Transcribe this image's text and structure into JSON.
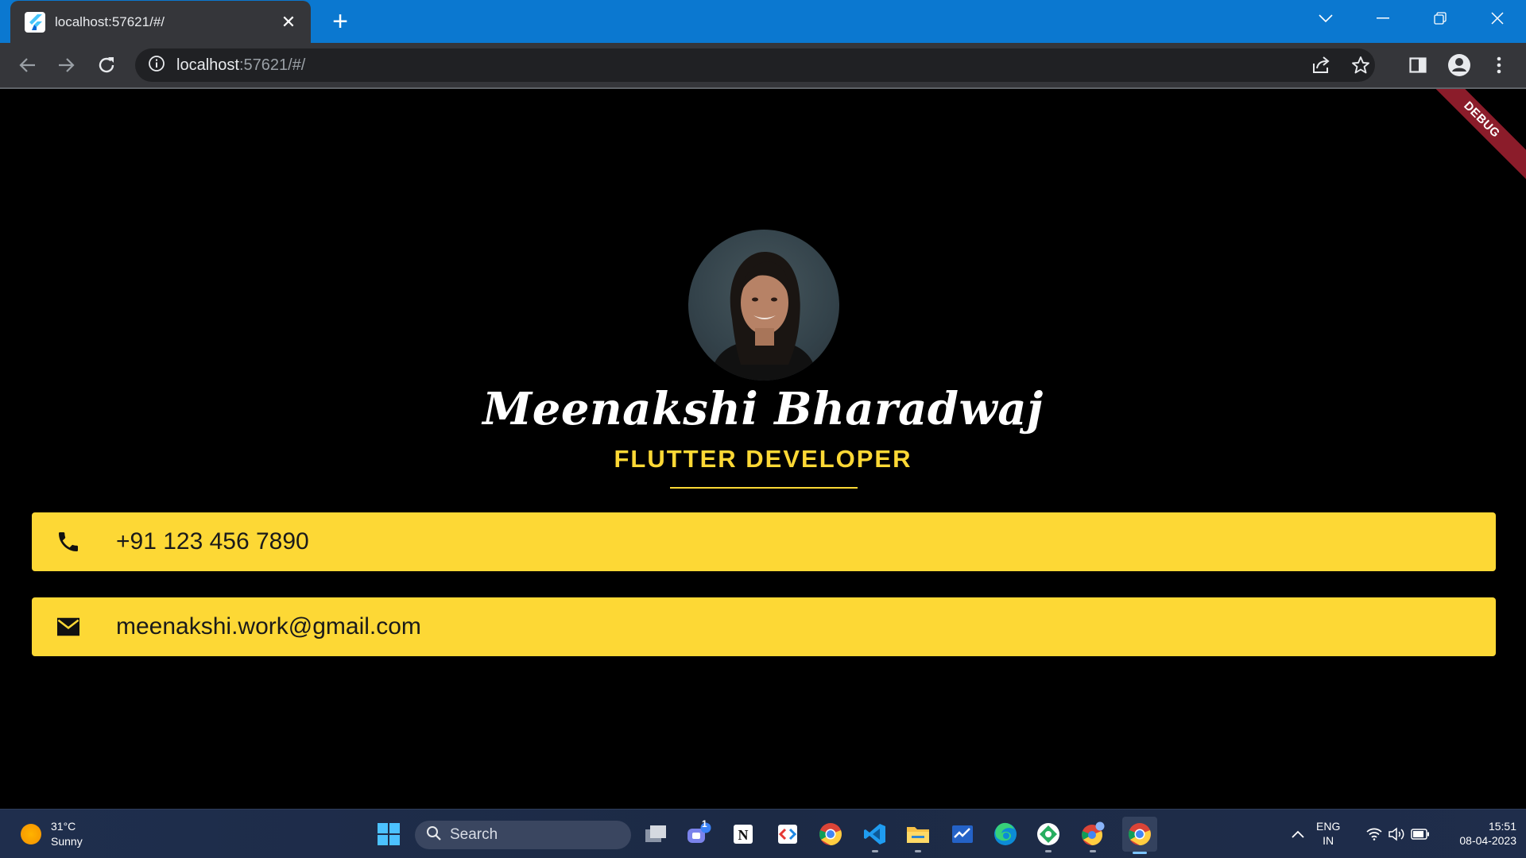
{
  "browser": {
    "tab_title": "localhost:57621/#/",
    "url_host": "localhost",
    "url_rest": ":57621/#/"
  },
  "page": {
    "debug_label": "DEBUG",
    "name": "Meenakshi Bharadwaj",
    "role": "FLUTTER DEVELOPER",
    "phone": "+91 123 456 7890",
    "email": "meenakshi.work@gmail.com",
    "colors": {
      "accent": "#fdd835",
      "background": "#000000",
      "card_text": "#1a1a1a"
    }
  },
  "taskbar": {
    "temperature": "31°C",
    "condition": "Sunny",
    "search_label": "Search",
    "teams_badge": "1",
    "language_line1": "ENG",
    "language_line2": "IN",
    "time": "15:51",
    "date": "08-04-2023"
  }
}
